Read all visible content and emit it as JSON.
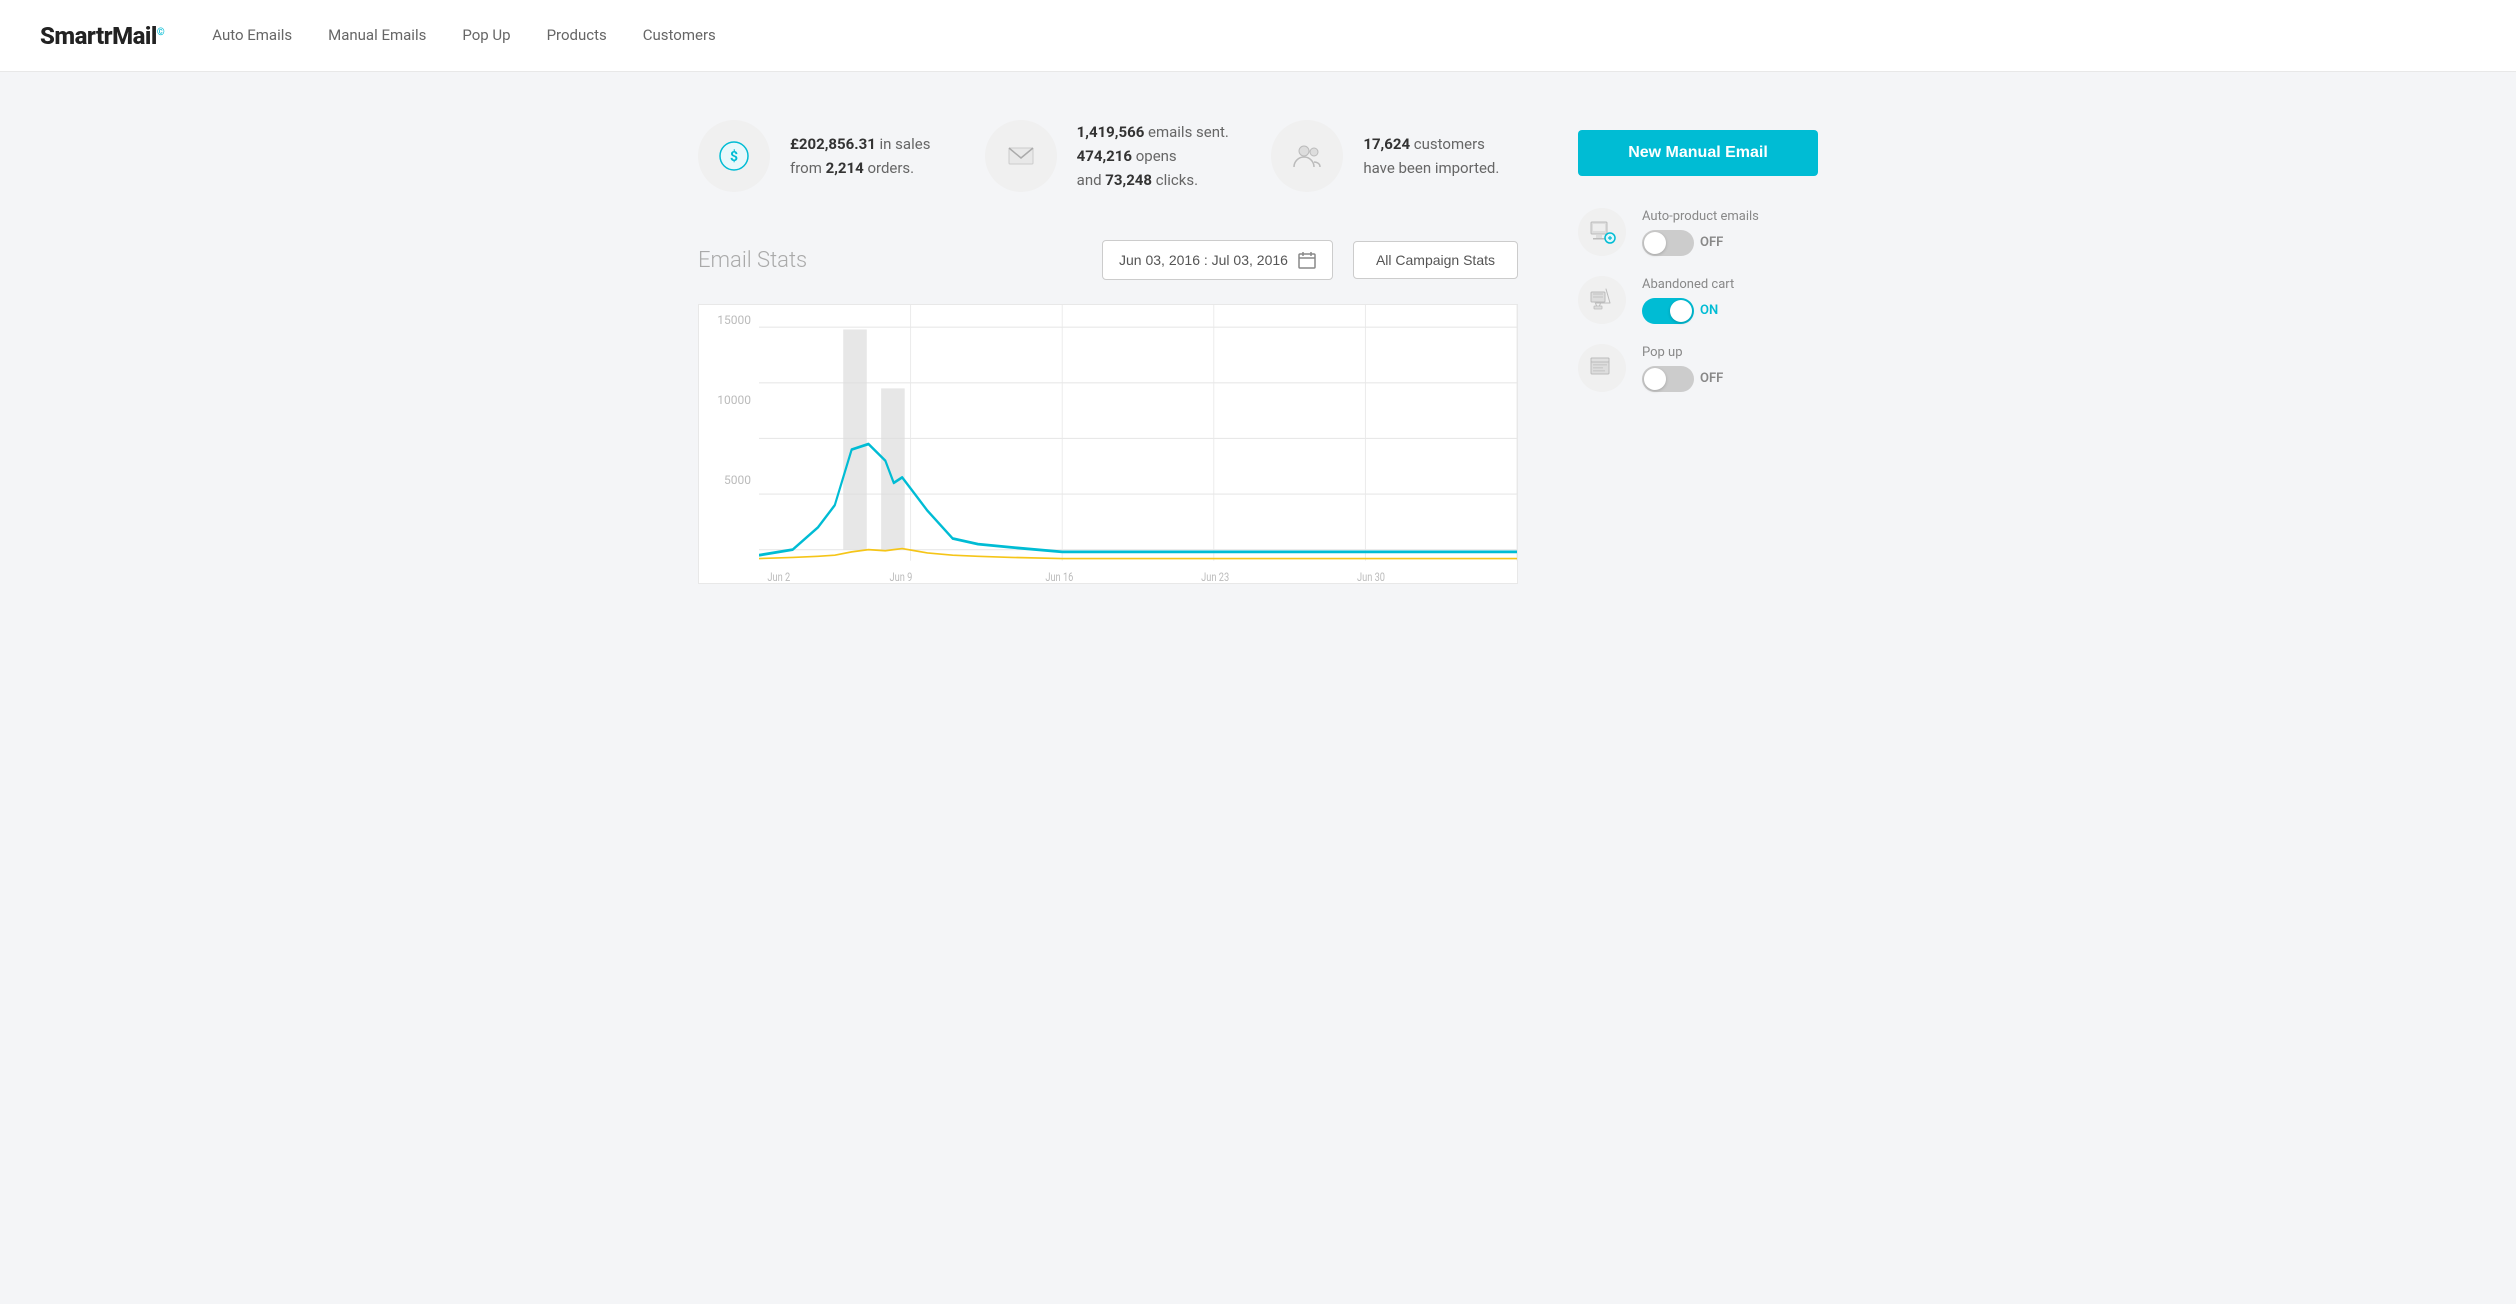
{
  "header": {
    "logo": "SmartrMail",
    "logo_dot": "©",
    "nav": [
      {
        "label": "Auto Emails",
        "id": "auto-emails"
      },
      {
        "label": "Manual Emails",
        "id": "manual-emails"
      },
      {
        "label": "Pop Up",
        "id": "pop-up"
      },
      {
        "label": "Products",
        "id": "products"
      },
      {
        "label": "Customers",
        "id": "customers"
      }
    ]
  },
  "stats": [
    {
      "id": "sales",
      "value": "£202,856.31",
      "text_parts": [
        "£202,856.31 in sales from ",
        "2,214",
        " orders."
      ],
      "bold_indexes": [
        0,
        1
      ]
    },
    {
      "id": "emails",
      "text_parts": [
        "1,419,566",
        " emails sent. ",
        "474,216",
        " opens and ",
        "73,248",
        " clicks."
      ]
    },
    {
      "id": "customers",
      "text_parts": [
        "17,624",
        " customers have been imported."
      ]
    }
  ],
  "chart": {
    "title": "Email Stats",
    "date_range": "Jun 03, 2016 : Jul 03, 2016",
    "all_campaign_btn": "All Campaign Stats",
    "y_labels": [
      "15000",
      "10000",
      "5000",
      ""
    ],
    "x_labels": [
      "Jun 2",
      "Jun 9",
      "Jun 16",
      "Jun 23",
      "Jun 30"
    ]
  },
  "sidebar": {
    "new_manual_btn": "New Manual Email",
    "toggles": [
      {
        "id": "auto-product",
        "label": "Auto-product emails",
        "state": "off"
      },
      {
        "id": "abandoned-cart",
        "label": "Abandoned cart",
        "state": "on"
      },
      {
        "id": "pop-up",
        "label": "Pop up",
        "state": "off"
      }
    ]
  }
}
